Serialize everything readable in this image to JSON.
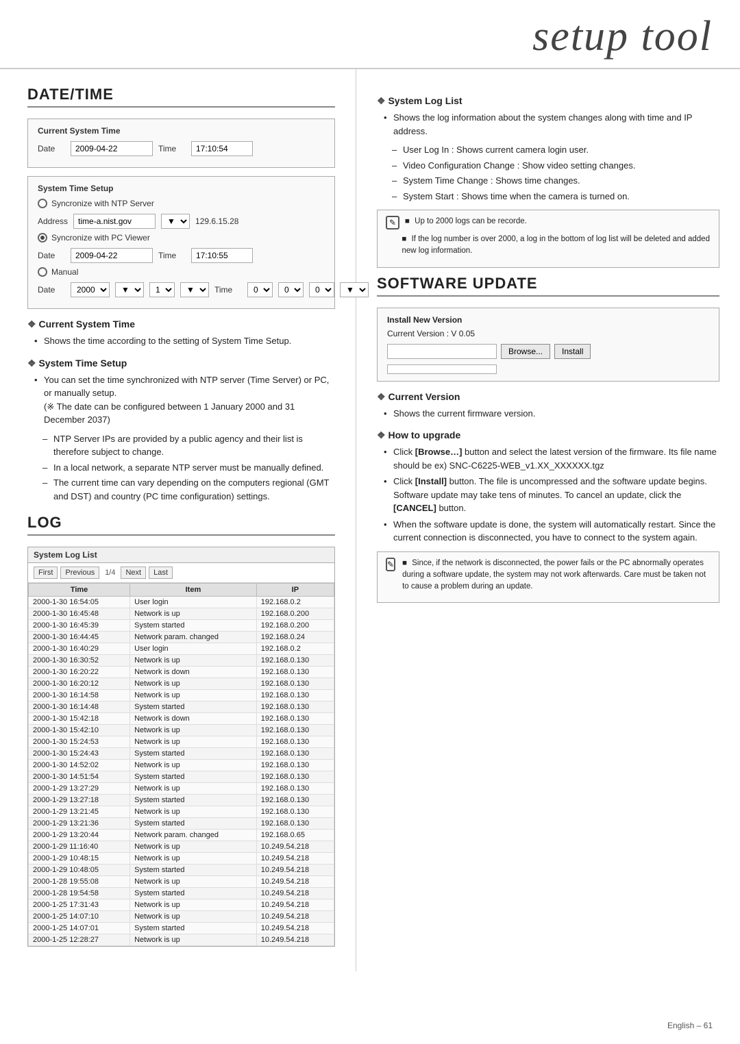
{
  "header": {
    "title": "setup tool"
  },
  "left": {
    "date_time_section": "DATE/TIME",
    "current_system_time": {
      "label": "Current System Time",
      "date_label": "Date",
      "date_value": "2009-04-22",
      "time_label": "Time",
      "time_value": "17:10:54"
    },
    "system_time_setup": {
      "label": "System Time Setup",
      "ntp_radio_label": "Syncronize with NTP Server",
      "address_label": "Address",
      "address_value": "time-a.nist.gov",
      "address_extra": "129.6.15.28",
      "pc_radio_label": "Syncronize with PC Viewer",
      "pc_date_label": "Date",
      "pc_date_value": "2009-04-22",
      "pc_time_label": "Time",
      "pc_time_value": "17:10:55",
      "manual_radio_label": "Manual",
      "manual_date_label": "Date",
      "manual_date_value": "2000",
      "manual_time_label": "Time"
    },
    "current_system_time_desc": {
      "title": "Current System Time",
      "bullet1": "Shows the time according to the setting of System Time Setup."
    },
    "system_time_setup_desc": {
      "title": "System Time Setup",
      "bullet1": "You can set the time synchronized with NTP server (Time Server) or PC, or manually setup.",
      "note1": "(※ The date can be configured between 1 January 2000 and 31 December 2037)",
      "dash1": "NTP Server IPs are provided by a public agency and their list is therefore subject to change.",
      "dash2": "In a local network, a separate NTP server must be manually defined.",
      "dash3": "The current time can vary depending on the computers regional (GMT and DST) and country (PC time configuration) settings."
    },
    "log_section": "LOG",
    "log_table": {
      "title": "System Log List",
      "nav_first": "First",
      "nav_prev": "Previous",
      "nav_page": "1/4",
      "nav_next": "Next",
      "nav_last": "Last",
      "col_time": "Time",
      "col_item": "Item",
      "col_ip": "IP",
      "rows": [
        {
          "time": "2000-1-30 16:54:05",
          "item": "User login",
          "ip": "192.168.0.2"
        },
        {
          "time": "2000-1-30 16:45:48",
          "item": "Network is up",
          "ip": "192.168.0.200"
        },
        {
          "time": "2000-1-30 16:45:39",
          "item": "System started",
          "ip": "192.168.0.200"
        },
        {
          "time": "2000-1-30 16:44:45",
          "item": "Network param. changed",
          "ip": "192.168.0.24"
        },
        {
          "time": "2000-1-30 16:40:29",
          "item": "User login",
          "ip": "192.168.0.2"
        },
        {
          "time": "2000-1-30 16:30:52",
          "item": "Network is up",
          "ip": "192.168.0.130"
        },
        {
          "time": "2000-1-30 16:20:22",
          "item": "Network is down",
          "ip": "192.168.0.130"
        },
        {
          "time": "2000-1-30 16:20:12",
          "item": "Network is up",
          "ip": "192.168.0.130"
        },
        {
          "time": "2000-1-30 16:14:58",
          "item": "Network is up",
          "ip": "192.168.0.130"
        },
        {
          "time": "2000-1-30 16:14:48",
          "item": "System started",
          "ip": "192.168.0.130"
        },
        {
          "time": "2000-1-30 15:42:18",
          "item": "Network is down",
          "ip": "192.168.0.130"
        },
        {
          "time": "2000-1-30 15:42:10",
          "item": "Network is up",
          "ip": "192.168.0.130"
        },
        {
          "time": "2000-1-30 15:24:53",
          "item": "Network is up",
          "ip": "192.168.0.130"
        },
        {
          "time": "2000-1-30 15:24:43",
          "item": "System started",
          "ip": "192.168.0.130"
        },
        {
          "time": "2000-1-30 14:52:02",
          "item": "Network is up",
          "ip": "192.168.0.130"
        },
        {
          "time": "2000-1-30 14:51:54",
          "item": "System started",
          "ip": "192.168.0.130"
        },
        {
          "time": "2000-1-29 13:27:29",
          "item": "Network is up",
          "ip": "192.168.0.130"
        },
        {
          "time": "2000-1-29 13:27:18",
          "item": "System started",
          "ip": "192.168.0.130"
        },
        {
          "time": "2000-1-29 13:21:45",
          "item": "Network is up",
          "ip": "192.168.0.130"
        },
        {
          "time": "2000-1-29 13:21:36",
          "item": "System started",
          "ip": "192.168.0.130"
        },
        {
          "time": "2000-1-29 13:20:44",
          "item": "Network param. changed",
          "ip": "192.168.0.65"
        },
        {
          "time": "2000-1-29 11:16:40",
          "item": "Network is up",
          "ip": "10.249.54.218"
        },
        {
          "time": "2000-1-29 10:48:15",
          "item": "Network is up",
          "ip": "10.249.54.218"
        },
        {
          "time": "2000-1-29 10:48:05",
          "item": "System started",
          "ip": "10.249.54.218"
        },
        {
          "time": "2000-1-28 19:55:08",
          "item": "Network is up",
          "ip": "10.249.54.218"
        },
        {
          "time": "2000-1-28 19:54:58",
          "item": "System started",
          "ip": "10.249.54.218"
        },
        {
          "time": "2000-1-25 17:31:43",
          "item": "Network is up",
          "ip": "10.249.54.218"
        },
        {
          "time": "2000-1-25 14:07:10",
          "item": "Network is up",
          "ip": "10.249.54.218"
        },
        {
          "time": "2000-1-25 14:07:01",
          "item": "System started",
          "ip": "10.249.54.218"
        },
        {
          "time": "2000-1-25 12:28:27",
          "item": "Network is up",
          "ip": "10.249.54.218"
        }
      ]
    }
  },
  "right": {
    "system_log_list": {
      "title": "System Log List",
      "bullet1": "Shows the log information about the system changes along with time and IP address.",
      "dash1": "User Log In : Shows current camera login user.",
      "dash2": "Video Configuration Change : Show video setting changes.",
      "dash3": "System Time Change : Shows time changes.",
      "dash4": "System Start : Shows time when the camera is turned on."
    },
    "note_box": {
      "note1": "Up to 2000 logs can be recorde.",
      "note2": "If the log number is over 2000, a log in the bottom of log list will be deleted and added new log information."
    },
    "software_update": {
      "section_title": "SOFTWARE UPDATE",
      "install_box_title": "Install New Version",
      "current_version_label": "Current Version : V 0.05",
      "browse_btn": "Browse...",
      "install_btn": "Install"
    },
    "current_version": {
      "title": "Current Version",
      "bullet1": "Shows the current firmware version."
    },
    "how_to_upgrade": {
      "title": "How to upgrade",
      "bullet1_pre": "Click ",
      "bullet1_bold": "[Browse…]",
      "bullet1_post": " button and select the latest version of the firmware. Its file name should be ex) SNC-C6225-WEB_v1.XX_XXXXXX.tgz",
      "bullet2_pre": "Click ",
      "bullet2_bold": "[Install]",
      "bullet2_post": " button. The file is uncompressed and the software update begins. Software update may take tens of minutes. To cancel an update, click the ",
      "bullet2_cancel": "[CANCEL]",
      "bullet2_end": " button.",
      "bullet3": "When the software update is done, the system will automatically restart. Since the current connection is disconnected, you have to connect to the system again.",
      "note_text": "Since, if the network is disconnected, the power fails or the PC abnormally operates during a software update, the system may not work afterwards. Care must be taken not to cause a problem during an update."
    }
  },
  "footer": {
    "lang": "English",
    "page": "61"
  }
}
